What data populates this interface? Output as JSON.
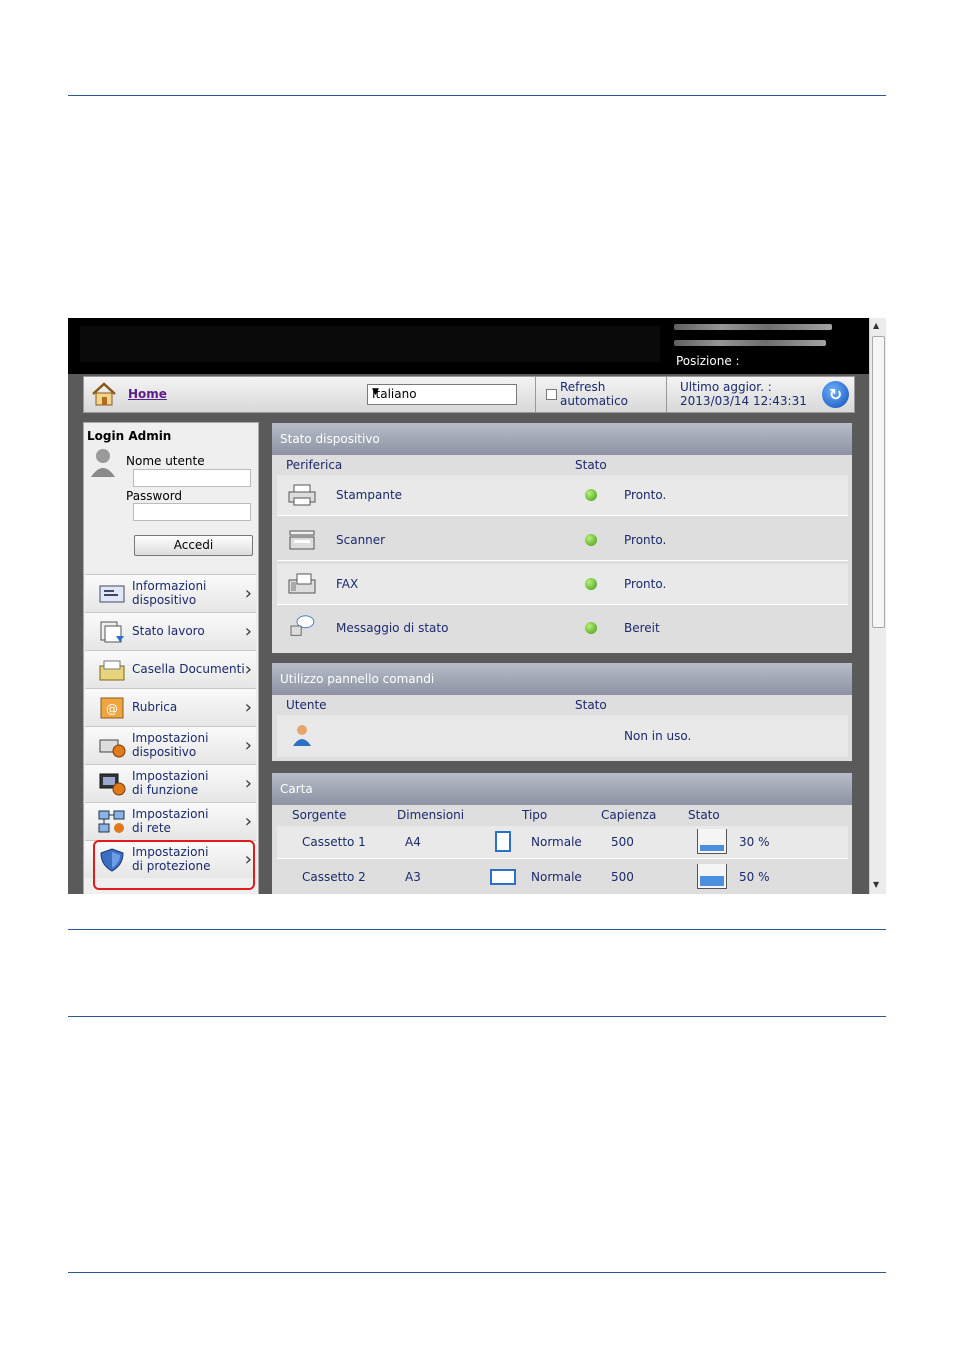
{
  "window": {
    "position_label": "Posizione :"
  },
  "nav": {
    "home": "Home",
    "language": "Italiano",
    "refresh_line1": "Refresh",
    "refresh_line2": "automatico",
    "last_update_label": "Ultimo aggior. :",
    "last_update_value": "2013/03/14 12:43:31"
  },
  "login": {
    "title": "Login Admin",
    "username_label": "Nome utente",
    "password_label": "Password",
    "button": "Accedi"
  },
  "sidebar": {
    "items": [
      {
        "line1": "Informazioni",
        "line2": "dispositivo",
        "icon": "device-info-icon"
      },
      {
        "line1": "Stato lavoro",
        "line2": "",
        "icon": "job-status-icon"
      },
      {
        "line1": "Casella Documenti",
        "line2": "",
        "icon": "document-box-icon"
      },
      {
        "line1": "Rubrica",
        "line2": "",
        "icon": "address-book-icon"
      },
      {
        "line1": "Impostazioni",
        "line2": "dispositivo",
        "icon": "device-settings-icon"
      },
      {
        "line1": "Impostazioni",
        "line2": "di funzione",
        "icon": "function-settings-icon"
      },
      {
        "line1": "Impostazioni",
        "line2": "di rete",
        "icon": "network-settings-icon"
      },
      {
        "line1": "Impostazioni",
        "line2": "di protezione",
        "icon": "security-shield-icon"
      }
    ]
  },
  "device_status": {
    "title": "Stato dispositivo",
    "col_device": "Periferica",
    "col_status": "Stato",
    "rows": [
      {
        "name": "Stampante",
        "status": "Pronto.",
        "icon": "printer-icon"
      },
      {
        "name": "Scanner",
        "status": "Pronto.",
        "icon": "scanner-icon"
      },
      {
        "name": "FAX",
        "status": "Pronto.",
        "icon": "fax-icon"
      },
      {
        "name": "Messaggio di stato",
        "status": "Bereit",
        "icon": "status-message-icon"
      }
    ]
  },
  "panel_usage": {
    "title": "Utilizzo pannello comandi",
    "col_user": "Utente",
    "col_status": "Stato",
    "status": "Non in uso."
  },
  "paper": {
    "title": "Carta",
    "col_source": "Sorgente",
    "col_size": "Dimensioni",
    "col_type": "Tipo",
    "col_capacity": "Capienza",
    "col_status": "Stato",
    "rows": [
      {
        "source": "Cassetto 1",
        "size": "A4",
        "type": "Normale",
        "capacity": "500",
        "level": "30 %",
        "level_pct": 30
      },
      {
        "source": "Cassetto 2",
        "size": "A3",
        "type": "Normale",
        "capacity": "500",
        "level": "50 %",
        "level_pct": 50
      }
    ]
  },
  "colors": {
    "accent": "#2a5b9c",
    "link": "#1a2a6c",
    "highlight": "#e01b1b",
    "status_ok": "#3e9a12"
  }
}
